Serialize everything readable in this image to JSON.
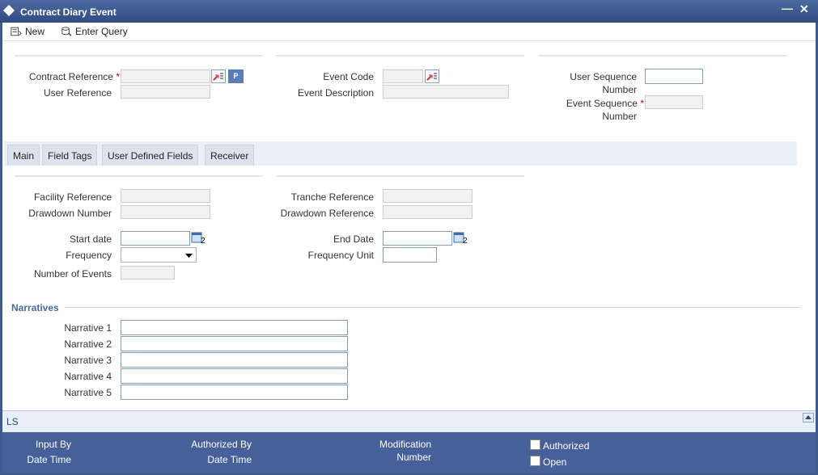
{
  "window": {
    "title": "Contract Diary Event",
    "minimize_icon": "minimize-icon",
    "close_icon": "close-icon"
  },
  "toolbar": {
    "new_label": "New",
    "enter_query_label": "Enter Query"
  },
  "header": {
    "contract_reference": {
      "label": "Contract Reference",
      "required": "*",
      "value": ""
    },
    "user_reference": {
      "label": "User Reference",
      "value": ""
    },
    "event_code": {
      "label": "Event Code",
      "value": ""
    },
    "event_description": {
      "label": "Event Description",
      "value": ""
    },
    "user_sequence_number": {
      "label_line1": "User Sequence",
      "label_line2": "Number",
      "value": ""
    },
    "event_sequence_number": {
      "label_line1": "Event Sequence",
      "required": "*",
      "label_line2": "Number",
      "value": ""
    },
    "p_button": "P"
  },
  "tabs": [
    "Main",
    "Field Tags",
    "User Defined Fields",
    "Receiver"
  ],
  "main": {
    "facility_reference": "Facility Reference",
    "drawdown_number": "Drawdown Number",
    "tranche_reference": "Tranche Reference",
    "drawdown_reference": "Drawdown Reference",
    "start_date": "Start date",
    "end_date": "End Date",
    "frequency": "Frequency",
    "frequency_unit": "Frequency Unit",
    "number_of_events": "Number of Events",
    "frequency_value": ""
  },
  "narratives": {
    "heading": "Narratives",
    "items": [
      "Narrative 1",
      "Narrative 2",
      "Narrative 3",
      "Narrative 4",
      "Narrative 5"
    ]
  },
  "status": {
    "text": "LS"
  },
  "footer": {
    "input_by": "Input By",
    "date_time_1": "Date Time",
    "authorized_by": "Authorized By",
    "date_time_2": "Date Time",
    "modification_line1": "Modification",
    "modification_line2": "Number",
    "authorized": "Authorized",
    "open": "Open"
  },
  "colors": {
    "titlebar": "#2f4b80",
    "footer": "#46609a",
    "required": "#cc0000",
    "section": "#4a6a9c"
  }
}
